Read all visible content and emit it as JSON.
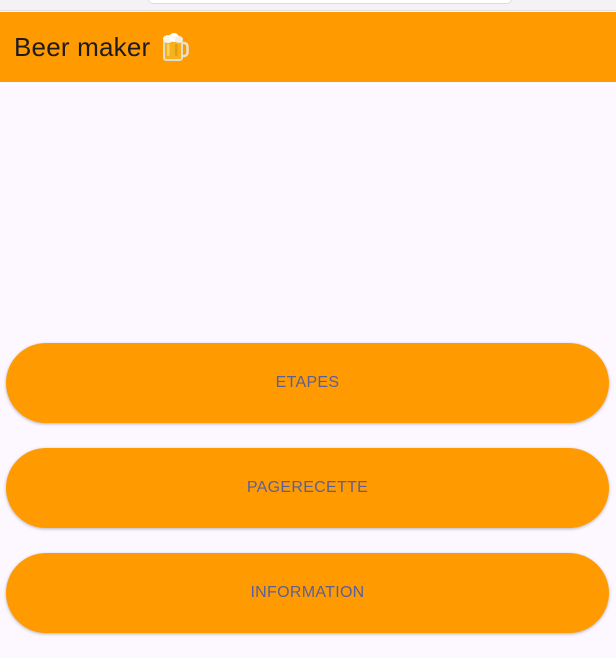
{
  "app_bar": {
    "title": "Beer maker",
    "icon": "beer-mug-icon",
    "background": "#ff9b00"
  },
  "buttons": [
    {
      "label": "ETAPES"
    },
    {
      "label": "PAGERECETTE"
    },
    {
      "label": "INFORMATION"
    }
  ],
  "colors": {
    "button_background": "#ff9b00",
    "button_text": "#5b5f97",
    "page_background": "#fdf7ff"
  }
}
